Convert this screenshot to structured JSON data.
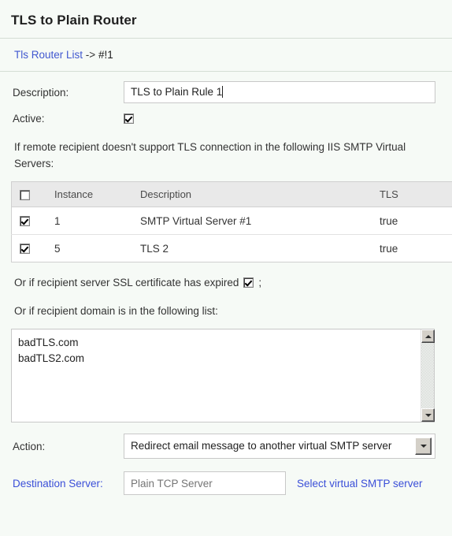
{
  "header": {
    "title": "TLS to Plain Router",
    "breadcrumb": {
      "link_label": "Tls Router List",
      "separator": "->",
      "current": "#!1"
    }
  },
  "form": {
    "description_label": "Description:",
    "description_value": "TLS to Plain Rule 1",
    "description_placeholder": "",
    "active_label": "Active:",
    "active_checked": true
  },
  "instructions": {
    "virtual_servers_text": "If remote recipient doesn't support TLS connection in the following IIS SMTP Virtual Servers:",
    "ssl_expired_text": "Or if recipient server SSL certificate has expired",
    "ssl_expired_suffix": ";",
    "ssl_expired_checked": true,
    "domain_list_text": "Or if recipient domain is in the following list:"
  },
  "table": {
    "columns": [
      "",
      "Instance",
      "Description",
      "TLS"
    ],
    "header_checkbox_checked": false,
    "rows": [
      {
        "checked": true,
        "instance": "1",
        "description": "SMTP Virtual Server #1",
        "tls": "true"
      },
      {
        "checked": true,
        "instance": "5",
        "description": "TLS 2",
        "tls": "true"
      }
    ]
  },
  "domain_list": {
    "value": "badTLS.com\nbadTLS2.com",
    "scroll_up_icon": "scroll-up-arrow-icon",
    "scroll_down_icon": "scroll-down-arrow-icon"
  },
  "action": {
    "label": "Action:",
    "selected": "Redirect email message to another virtual SMTP server",
    "dropdown_icon": "chevron-down-icon"
  },
  "destination": {
    "label": "Destination Server:",
    "placeholder": "Plain TCP Server",
    "value": "",
    "select_link": "Select virtual SMTP server"
  },
  "colors": {
    "background": "#f6faf6",
    "link": "#3b4fd8",
    "divider": "#d5ded5",
    "table_header_bg": "#e9e9e9",
    "text": "#333333"
  }
}
